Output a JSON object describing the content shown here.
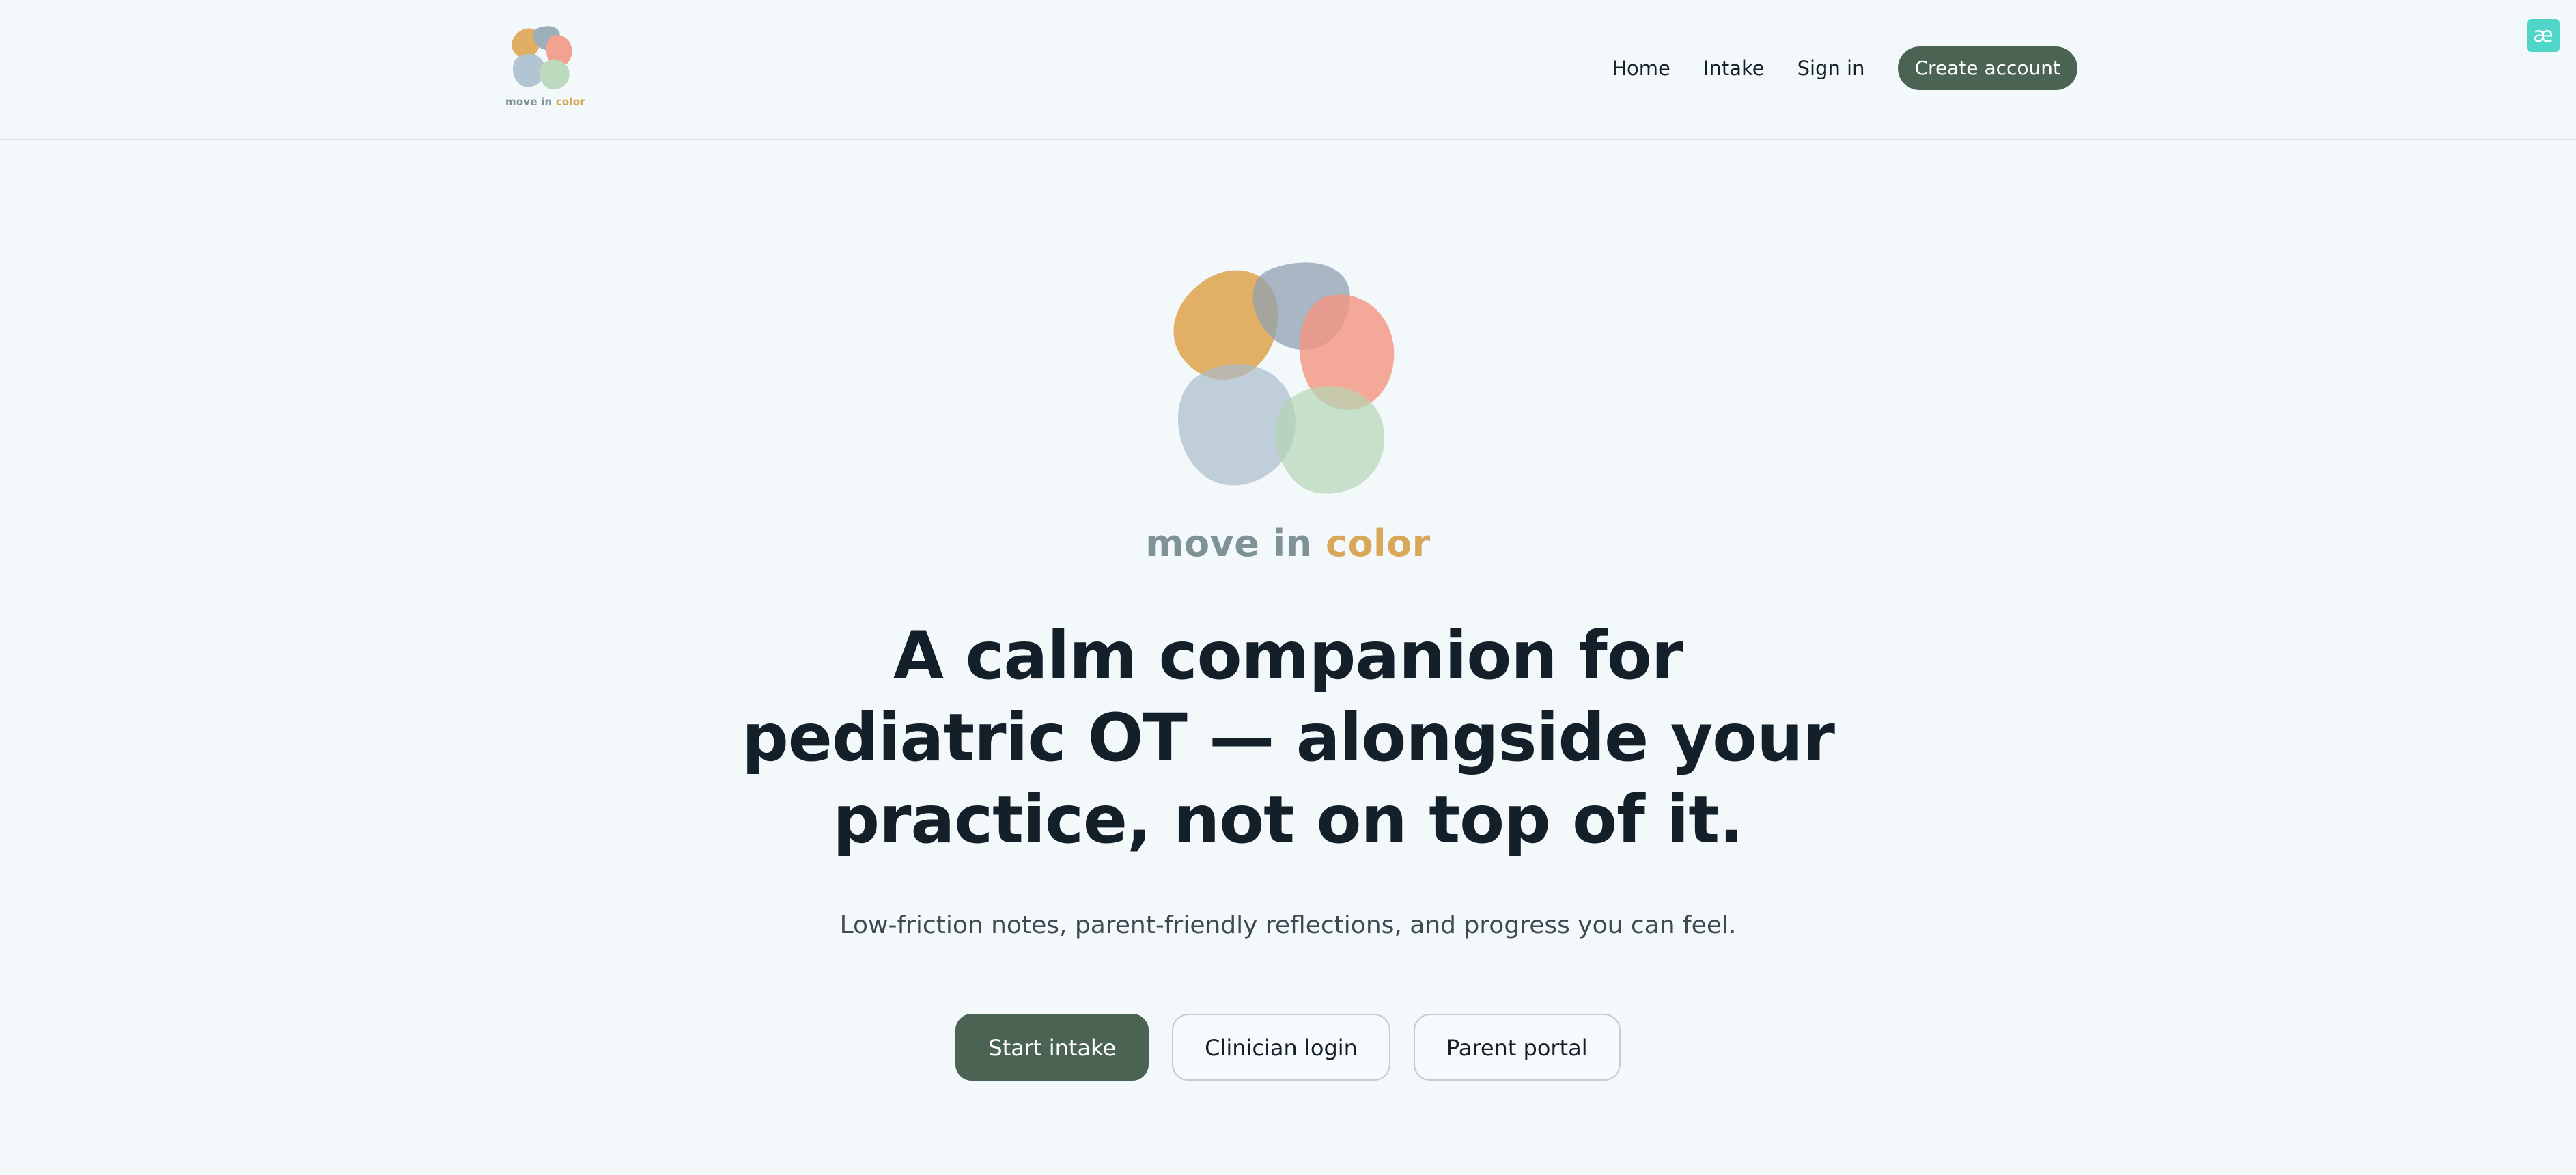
{
  "brand": {
    "word_part1": "move in",
    "word_part2": "color",
    "colors": {
      "grey": "#7f9298",
      "gold": "#d9a75a",
      "blob_gold": "#dda24a",
      "blob_slate": "#8fa2b0",
      "blob_coral": "#f4937f",
      "blob_blue": "#a9bccc",
      "blob_green": "#b3d6b4"
    }
  },
  "nav": {
    "home": "Home",
    "intake": "Intake",
    "sign_in": "Sign in",
    "create_account": "Create account"
  },
  "extension_badge": "æ",
  "hero": {
    "headline_lines": [
      "A calm companion for",
      "pediatric OT — alongside your",
      "practice, not on top of it."
    ],
    "subline": "Low-friction notes, parent-friendly reflections, and progress you can feel.",
    "buttons": {
      "start_intake": "Start intake",
      "clinician_login": "Clinician login",
      "parent_portal": "Parent portal"
    }
  },
  "theme": {
    "background": "#f3f8fb",
    "accent": "#4b6353",
    "text": "#13202a"
  }
}
